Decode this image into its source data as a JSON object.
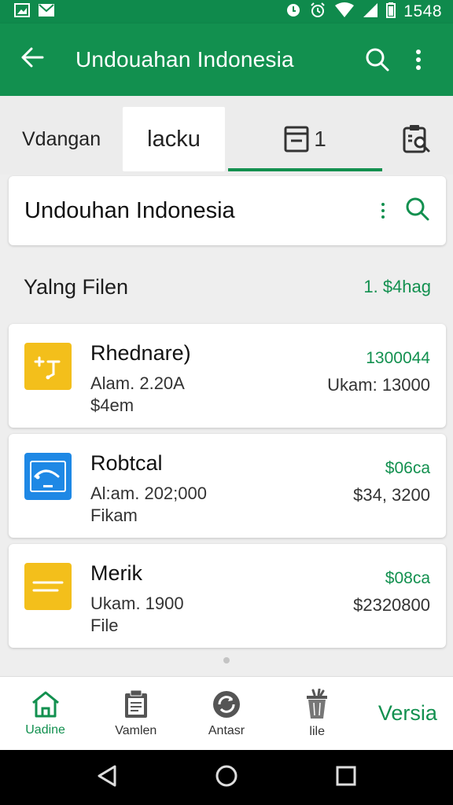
{
  "status_bar": {
    "time": "1548"
  },
  "app_bar": {
    "title": "Undouahan Indonesia"
  },
  "tabs": [
    {
      "label": "Vdangan"
    },
    {
      "label": "lacku"
    },
    {
      "label": "1"
    },
    {
      "label": ""
    }
  ],
  "search_card": {
    "title": "Undouhan Indonesia"
  },
  "section": {
    "label": "Yalng Filen",
    "value": "1. $4hag"
  },
  "files": [
    {
      "name": "Rhednare)",
      "meta1": "Alam. 2.20A",
      "meta2": "$4em",
      "amount": "1300044",
      "amount2": "Ukam: 13000",
      "icon": "document-edit-icon",
      "color": "#f3bf1b"
    },
    {
      "name": "Robtcal",
      "meta1": "Al:am. 202;000",
      "meta2": "Fikam",
      "amount": "$06ca",
      "amount2": "$34, 3200",
      "icon": "picture-icon",
      "color": "#1e88e5"
    },
    {
      "name": "Merik",
      "meta1": "Ukam. 1900",
      "meta2": "File",
      "amount": "$08ca",
      "amount2": "$2320800",
      "icon": "text-file-icon",
      "color": "#f3bf1b"
    }
  ],
  "bottom_nav": [
    {
      "label": "Uadine",
      "icon": "home-icon"
    },
    {
      "label": "Vamlen",
      "icon": "clipboard-icon"
    },
    {
      "label": "Antasr",
      "icon": "sync-icon"
    },
    {
      "label": "lile",
      "icon": "trash-icon"
    },
    {
      "label": "Versia"
    }
  ],
  "colors": {
    "primary": "#12904f",
    "yellow": "#f3bf1b",
    "blue": "#1e88e5"
  }
}
